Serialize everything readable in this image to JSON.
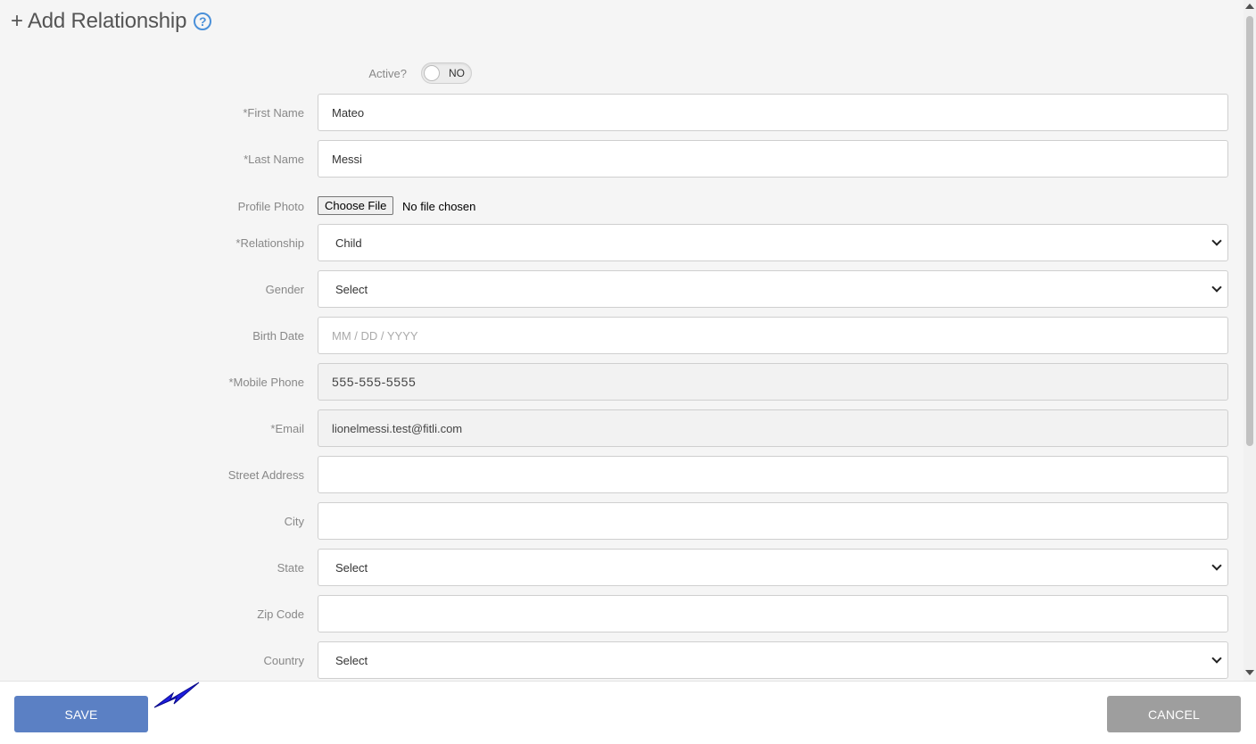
{
  "header": {
    "title": "+ Add Relationship",
    "help_icon": "question-circle-icon"
  },
  "active": {
    "label": "Active?",
    "state": "NO"
  },
  "form": {
    "first_name": {
      "label": "*First Name",
      "value": "Mateo"
    },
    "last_name": {
      "label": "*Last Name",
      "value": "Messi"
    },
    "profile_photo": {
      "label": "Profile Photo",
      "button": "Choose File",
      "status": "No file chosen"
    },
    "relationship": {
      "label": "*Relationship",
      "value": "Child"
    },
    "gender": {
      "label": "Gender",
      "value": "Select"
    },
    "birth_date": {
      "label": "Birth Date",
      "placeholder": "MM / DD / YYYY"
    },
    "mobile_phone": {
      "label": "*Mobile Phone",
      "value": "555-555-5555"
    },
    "email": {
      "label": "*Email",
      "value": "lionelmessi.test@fitli.com"
    },
    "street_address": {
      "label": "Street Address",
      "value": ""
    },
    "city": {
      "label": "City",
      "value": ""
    },
    "state": {
      "label": "State",
      "value": "Select"
    },
    "zip_code": {
      "label": "Zip Code",
      "value": ""
    },
    "country": {
      "label": "Country",
      "value": "Select"
    }
  },
  "footer": {
    "save_label": "SAVE",
    "cancel_label": "CANCEL"
  },
  "colors": {
    "save": "#5b80c4",
    "cancel": "#9e9e9e",
    "help": "#4a90d9",
    "pointer_arrow": "#1e1ee0"
  }
}
